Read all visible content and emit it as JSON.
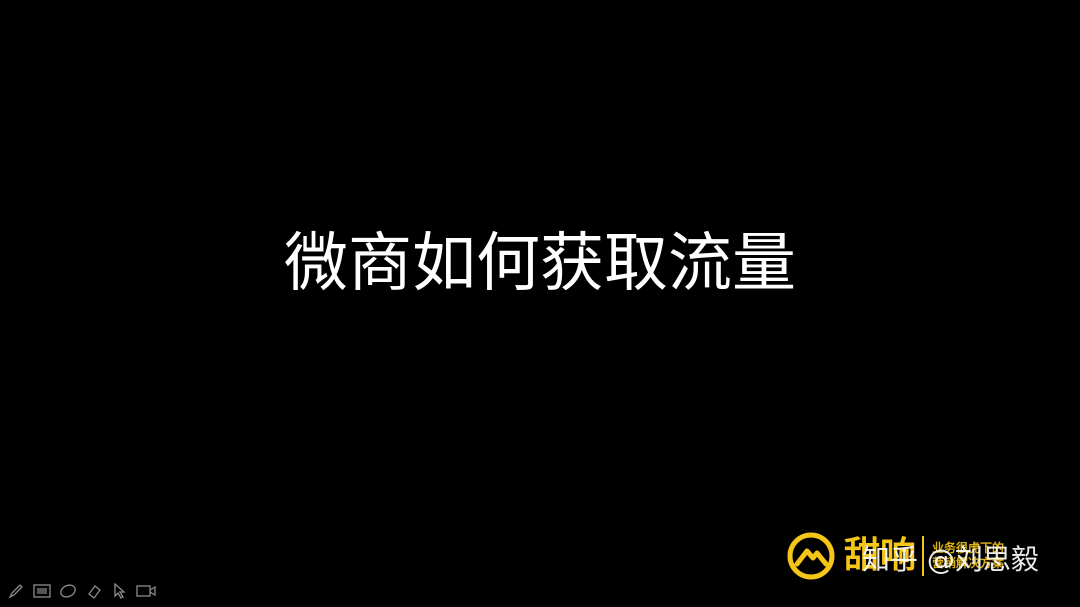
{
  "slide": {
    "title": "微商如何获取流量"
  },
  "branding": {
    "logo_name": "甜响",
    "slogan_line1": "业务很虎下的",
    "slogan_line2": "营销解决方案",
    "accent_color": "#f5c518"
  },
  "watermark": {
    "text": "知乎 @刘思毅"
  },
  "presenter_toolbar": {
    "tools": [
      {
        "icon": "pen-icon"
      },
      {
        "icon": "slides-grid-icon"
      },
      {
        "icon": "zoom-icon"
      },
      {
        "icon": "eraser-icon"
      },
      {
        "icon": "pointer-icon"
      },
      {
        "icon": "camera-icon"
      }
    ]
  }
}
